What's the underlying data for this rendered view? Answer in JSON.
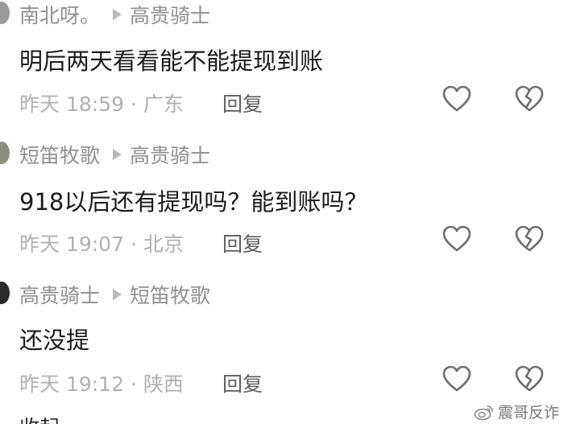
{
  "comments": [
    {
      "author": "南北呀。",
      "reply_to": "高贵骑士",
      "text": "明后两天看看能不能提现到账",
      "time_location": "昨天 18:59 · 广东",
      "reply_label": "回复",
      "avatar_color": "#9a9a9a"
    },
    {
      "author": "短笛牧歌",
      "reply_to": "高贵骑士",
      "text": "918以后还有提现吗？能到账吗？",
      "time_location": "昨天 19:07 · 北京",
      "reply_label": "回复",
      "avatar_color": "#8a8f7a"
    },
    {
      "author": "高贵骑士",
      "reply_to": "短笛牧歌",
      "text": "还没提",
      "time_location": "昨天 19:12 · 陕西",
      "reply_label": "回复",
      "avatar_color": "#2a2a2a"
    }
  ],
  "footer": {
    "collapse_label": "收起",
    "watermark": "震哥反诈"
  },
  "icons": {
    "like": "heart-outline-icon",
    "dislike": "broken-heart-icon",
    "arrow": "triangle-right-icon",
    "weibo": "weibo-logo-icon"
  },
  "colors": {
    "author": "#8f8f8f",
    "text": "#1b1b1b",
    "meta": "#b0b0b0",
    "reply": "#5e5e5e",
    "icon_stroke": "#6f6f6f"
  }
}
